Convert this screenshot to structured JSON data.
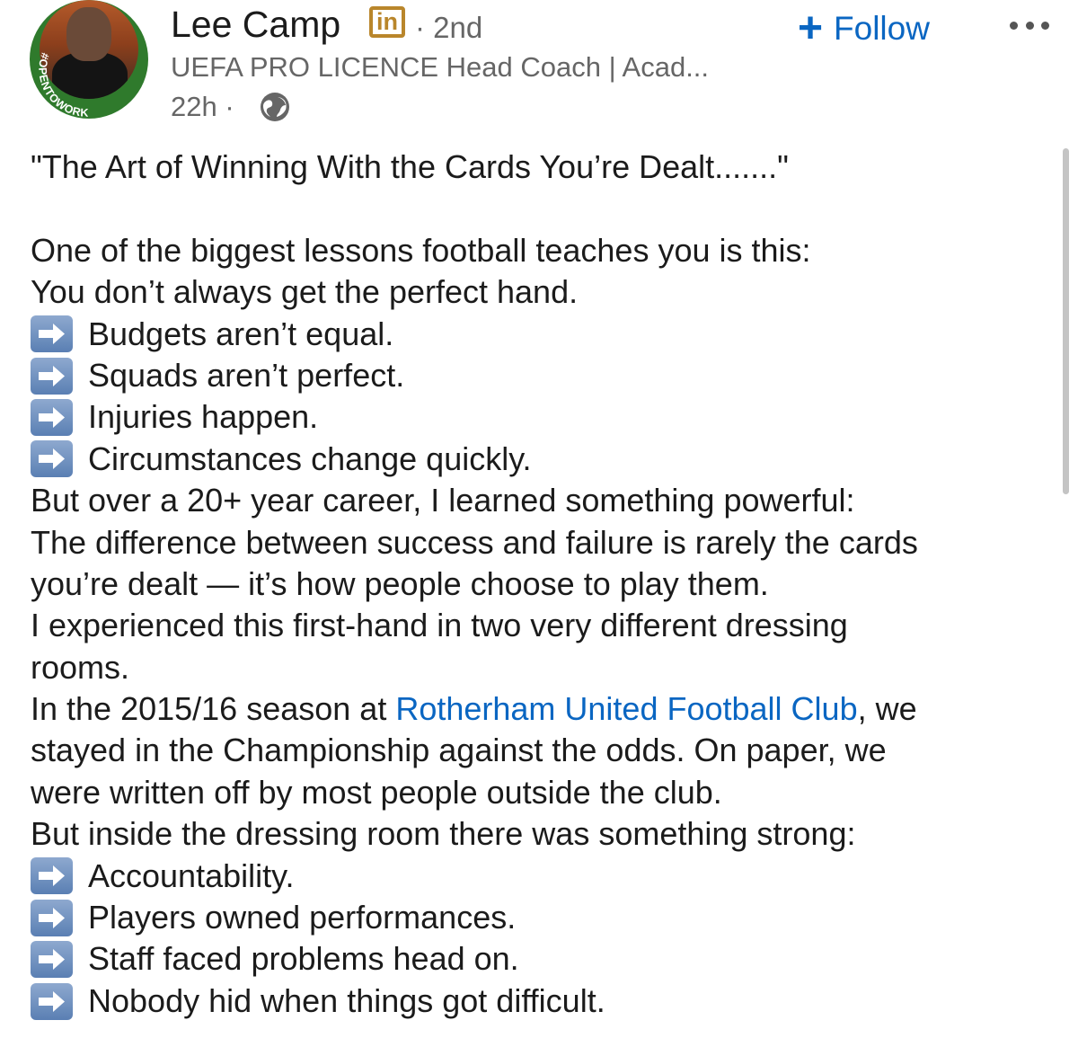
{
  "author": {
    "name": "Lee Camp",
    "network_badge": "in",
    "connection_degree": "· 2nd",
    "headline": "UEFA PRO LICENCE Head Coach | Acad...",
    "posted": "22h ·",
    "open_to_work_frame": "#OPENTOWORK"
  },
  "follow_button": {
    "plus": "+",
    "label": "Follow"
  },
  "post": {
    "title": "\"The Art of Winning With the Cards You’re Dealt.......\"",
    "lines_a": [
      "One of the biggest lessons football teaches you is this:",
      "You don’t always get the perfect hand."
    ],
    "bullets_a": [
      "Budgets aren’t equal.",
      "Squads aren’t perfect.",
      "Injuries happen.",
      "Circumstances change quickly."
    ],
    "lines_b": [
      "But over a 20+ year career, I learned something powerful:",
      "The difference between success and failure is rarely the cards",
      "you’re dealt — it’s how people choose to play them.",
      "I experienced this first-hand in two very different dressing",
      "rooms."
    ],
    "rotherham_line": {
      "prefix": "In the 2015/16 season at ",
      "link": "Rotherham United Football Club",
      "suffix": ", we"
    },
    "lines_c": [
      "stayed in the Championship against the odds. On paper, we",
      "were written off by most people outside the club.",
      "But inside the dressing room there was something strong:"
    ],
    "bullets_b": [
      "Accountability.",
      "Players owned performances.",
      "Staff faced problems head on.",
      "Nobody hid when things got difficult."
    ]
  },
  "colors": {
    "link": "#0a66c2",
    "text": "#1b1b1b",
    "secondary": "#666666",
    "premium_gold": "#b9862b",
    "open_to_work_green": "#2f7a2c"
  }
}
